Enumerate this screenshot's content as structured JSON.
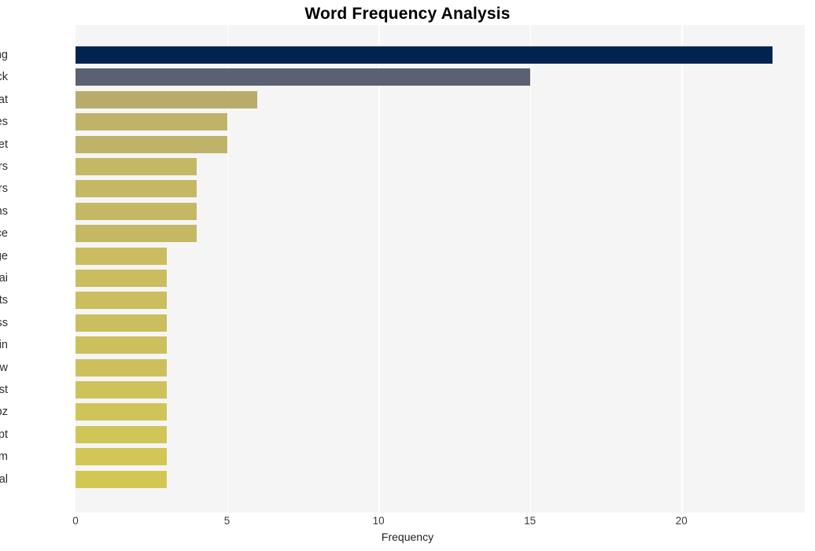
{
  "chart_data": {
    "type": "bar",
    "orientation": "horizontal",
    "title": "Word Frequency Analysis",
    "xlabel": "Frequency",
    "ylabel": "",
    "xlim": [
      0,
      24.07
    ],
    "xticks": [
      0,
      5,
      10,
      15,
      20
    ],
    "xtick_labels": [
      "0",
      "5",
      "10",
      "15",
      "20"
    ],
    "grid": "vertical-only",
    "legend": "none",
    "categories": [
      "phishing",
      "attack",
      "threat",
      "countries",
      "target",
      "actors",
      "users",
      "platforms",
      "experience",
      "leverage",
      "genai",
      "aspects",
      "process",
      "remain",
      "grow",
      "trust",
      "threatlabz",
      "attempt",
      "scam",
      "digital"
    ],
    "values": [
      23,
      15,
      6,
      5,
      5,
      4,
      4,
      4,
      4,
      3,
      3,
      3,
      3,
      3,
      3,
      3,
      3,
      3,
      3,
      3
    ],
    "bar_colors": [
      "#00244f",
      "#5b6073",
      "#b7ac6c",
      "#bfb269",
      "#bfb269",
      "#c5b864",
      "#c5b864",
      "#c5b864",
      "#c5b864",
      "#c9bd60",
      "#c9bd60",
      "#cabe5f",
      "#cabe5f",
      "#ccc05d",
      "#ccc05d",
      "#cec25b",
      "#cfc459",
      "#d0c557",
      "#d2c655",
      "#d3c754"
    ]
  },
  "style": {
    "plot_background": "#f5f5f6",
    "figure_background": "#ffffff",
    "gridline_color": "#ffffff",
    "title_color": "#000000",
    "tick_label_color": "#3a3a3a"
  }
}
